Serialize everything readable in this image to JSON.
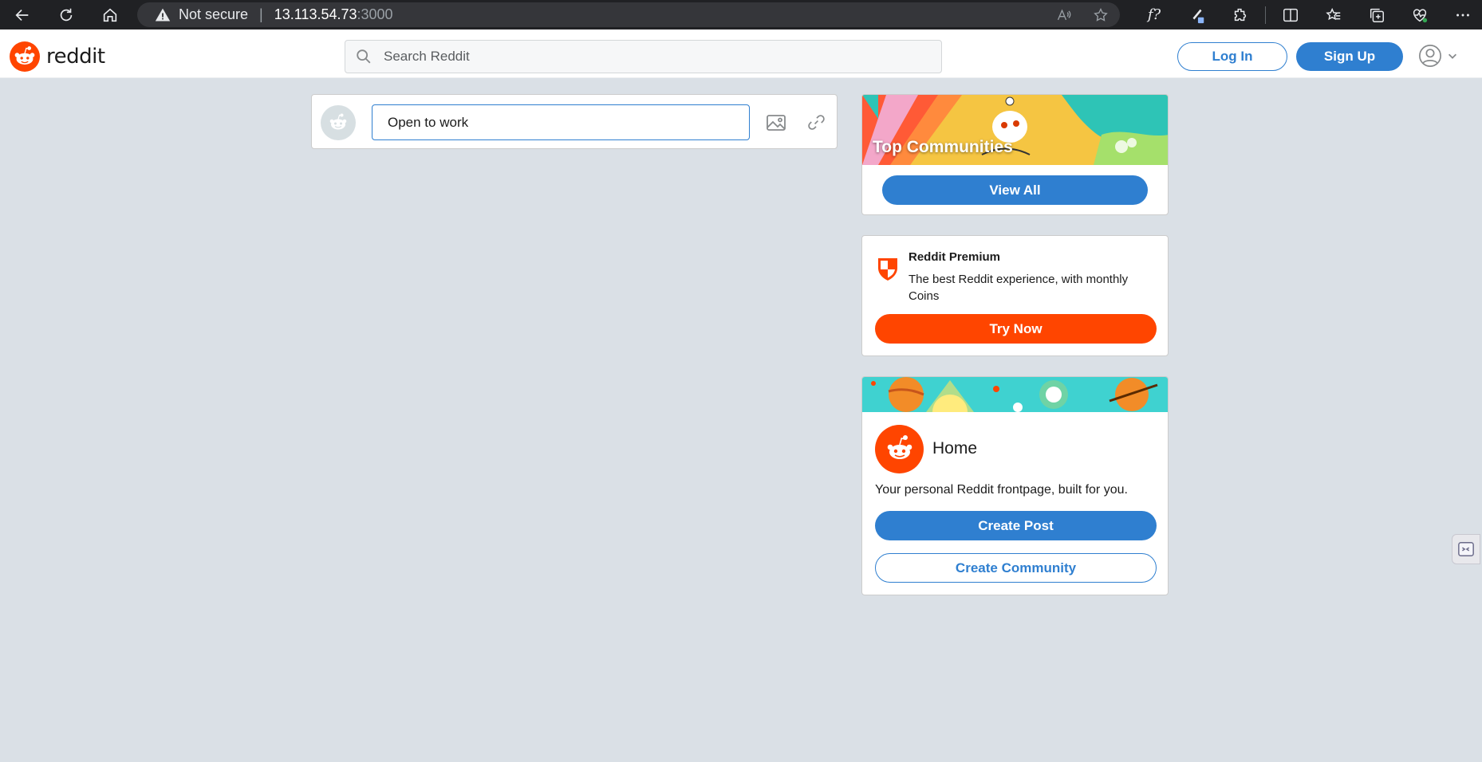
{
  "browser": {
    "security_label": "Not secure",
    "url_host": "13.113.54.73",
    "url_port": ":3000",
    "fx_label": "f?",
    "icons": [
      "back-icon",
      "refresh-icon",
      "home-icon",
      "warning-icon",
      "read-aloud-icon",
      "favorite-star-icon",
      "extensions-icon",
      "split-screen-icon",
      "favorites-icon",
      "collections-icon",
      "health-icon",
      "more-icon"
    ]
  },
  "header": {
    "logo_text": "reddit",
    "search_placeholder": "Search Reddit",
    "login_label": "Log In",
    "signup_label": "Sign Up"
  },
  "create_post": {
    "input_value": "Open to work"
  },
  "sidebar": {
    "top_communities": {
      "title": "Top Communities",
      "button": "View All"
    },
    "premium": {
      "title": "Reddit Premium",
      "description": "The best Reddit experience, with monthly Coins",
      "button": "Try Now"
    },
    "home": {
      "title": "Home",
      "description": "Your personal Reddit frontpage, built for you.",
      "create_post": "Create Post",
      "create_community": "Create Community"
    }
  },
  "colors": {
    "brand_orange": "#ff4500",
    "brand_blue": "#2f7fd0",
    "page_bg": "#dae0e6"
  }
}
